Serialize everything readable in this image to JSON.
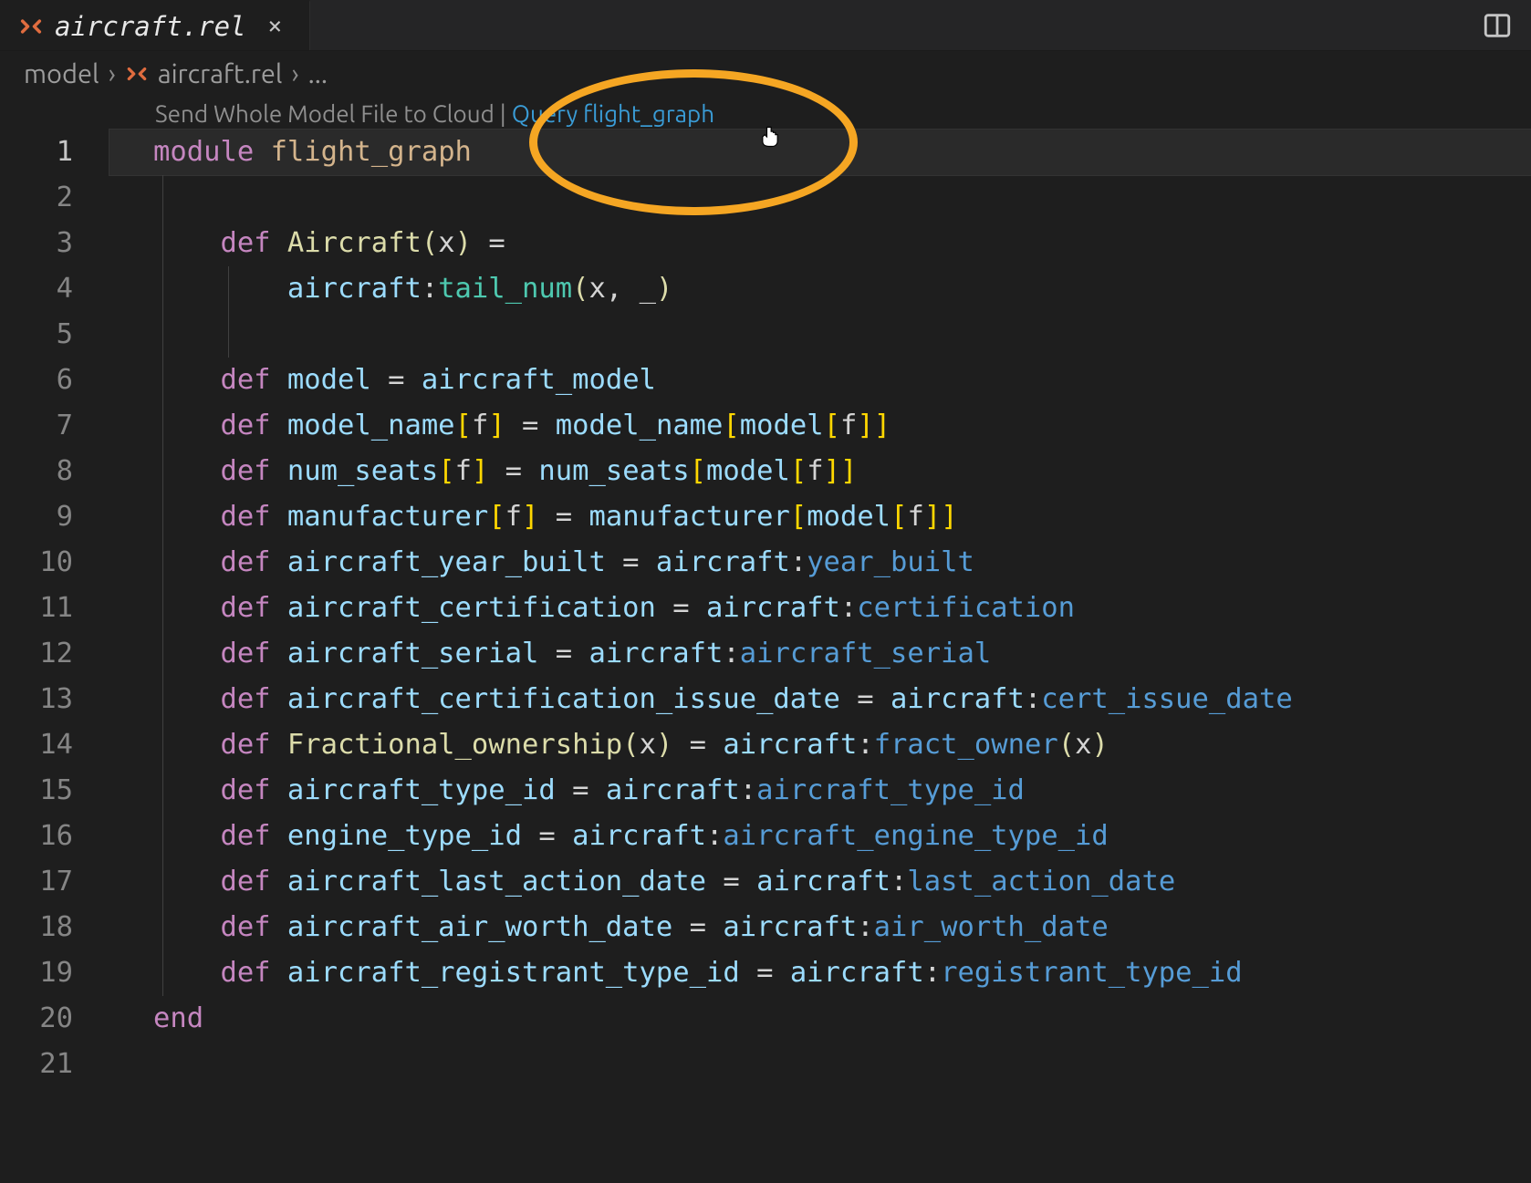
{
  "tab": {
    "filename": "aircraft.rel",
    "close_glyph": "×",
    "icon_name": "rel-file-icon"
  },
  "breadcrumbs": {
    "items": [
      {
        "label": "model",
        "icon": null
      },
      {
        "label": "aircraft.rel",
        "icon": "rel-file-icon"
      },
      {
        "label": "...",
        "icon": null
      }
    ],
    "separator": "›"
  },
  "codelens": {
    "send_label": "Send Whole Model File to Cloud",
    "separator": "|",
    "query_label": "Query flight_graph"
  },
  "annotation": {
    "highlight_color": "#f5a623",
    "cursor_icon": "pointer-hand"
  },
  "code": {
    "lines": [
      {
        "n": 1,
        "current": true,
        "tokens": [
          {
            "t": "module",
            "c": "kw-module"
          },
          {
            "t": " ",
            "c": "plain"
          },
          {
            "t": "flight_graph",
            "c": "flightg"
          }
        ]
      },
      {
        "n": 2,
        "tokens": []
      },
      {
        "n": 3,
        "indent": 2,
        "tokens": [
          {
            "t": "def",
            "c": "kw-def"
          },
          {
            "t": " ",
            "c": "plain"
          },
          {
            "t": "Aircraft",
            "c": "fnname"
          },
          {
            "t": "(",
            "c": "paren"
          },
          {
            "t": "x",
            "c": "plain"
          },
          {
            "t": ")",
            "c": "paren"
          },
          {
            "t": " = ",
            "c": "op"
          }
        ]
      },
      {
        "n": 4,
        "indent": 3,
        "tokens": [
          {
            "t": "aircraft",
            "c": "ns"
          },
          {
            "t": ":",
            "c": "plain"
          },
          {
            "t": "tail_num",
            "c": "prop"
          },
          {
            "t": "(",
            "c": "paren"
          },
          {
            "t": "x",
            "c": "plain"
          },
          {
            "t": ", ",
            "c": "plain"
          },
          {
            "t": "_",
            "c": "under"
          },
          {
            "t": ")",
            "c": "paren"
          }
        ]
      },
      {
        "n": 5,
        "tokens": []
      },
      {
        "n": 6,
        "indent": 2,
        "tokens": [
          {
            "t": "def",
            "c": "kw-def"
          },
          {
            "t": " ",
            "c": "plain"
          },
          {
            "t": "model",
            "c": "ident"
          },
          {
            "t": " = ",
            "c": "op"
          },
          {
            "t": "aircraft_model",
            "c": "ident"
          }
        ]
      },
      {
        "n": 7,
        "indent": 2,
        "tokens": [
          {
            "t": "def",
            "c": "kw-def"
          },
          {
            "t": " ",
            "c": "plain"
          },
          {
            "t": "model_name",
            "c": "ident"
          },
          {
            "t": "[",
            "c": "bracket"
          },
          {
            "t": "f",
            "c": "plain"
          },
          {
            "t": "]",
            "c": "bracket"
          },
          {
            "t": " = ",
            "c": "op"
          },
          {
            "t": "model_name",
            "c": "ident"
          },
          {
            "t": "[",
            "c": "bracket"
          },
          {
            "t": "model",
            "c": "ident"
          },
          {
            "t": "[",
            "c": "bracket"
          },
          {
            "t": "f",
            "c": "plain"
          },
          {
            "t": "]",
            "c": "bracket"
          },
          {
            "t": "]",
            "c": "bracket"
          }
        ]
      },
      {
        "n": 8,
        "indent": 2,
        "tokens": [
          {
            "t": "def",
            "c": "kw-def"
          },
          {
            "t": " ",
            "c": "plain"
          },
          {
            "t": "num_seats",
            "c": "ident"
          },
          {
            "t": "[",
            "c": "bracket"
          },
          {
            "t": "f",
            "c": "plain"
          },
          {
            "t": "]",
            "c": "bracket"
          },
          {
            "t": " = ",
            "c": "op"
          },
          {
            "t": "num_seats",
            "c": "ident"
          },
          {
            "t": "[",
            "c": "bracket"
          },
          {
            "t": "model",
            "c": "ident"
          },
          {
            "t": "[",
            "c": "bracket"
          },
          {
            "t": "f",
            "c": "plain"
          },
          {
            "t": "]",
            "c": "bracket"
          },
          {
            "t": "]",
            "c": "bracket"
          }
        ]
      },
      {
        "n": 9,
        "indent": 2,
        "tokens": [
          {
            "t": "def",
            "c": "kw-def"
          },
          {
            "t": " ",
            "c": "plain"
          },
          {
            "t": "manufacturer",
            "c": "ident"
          },
          {
            "t": "[",
            "c": "bracket"
          },
          {
            "t": "f",
            "c": "plain"
          },
          {
            "t": "]",
            "c": "bracket"
          },
          {
            "t": " = ",
            "c": "op"
          },
          {
            "t": "manufacturer",
            "c": "ident"
          },
          {
            "t": "[",
            "c": "bracket"
          },
          {
            "t": "model",
            "c": "ident"
          },
          {
            "t": "[",
            "c": "bracket"
          },
          {
            "t": "f",
            "c": "plain"
          },
          {
            "t": "]",
            "c": "bracket"
          },
          {
            "t": "]",
            "c": "bracket"
          }
        ]
      },
      {
        "n": 10,
        "indent": 2,
        "tokens": [
          {
            "t": "def",
            "c": "kw-def"
          },
          {
            "t": " ",
            "c": "plain"
          },
          {
            "t": "aircraft_year_built",
            "c": "ident"
          },
          {
            "t": " = ",
            "c": "op"
          },
          {
            "t": "aircraft",
            "c": "ns"
          },
          {
            "t": ":",
            "c": "plain"
          },
          {
            "t": "year_built",
            "c": "prop2"
          }
        ]
      },
      {
        "n": 11,
        "indent": 2,
        "tokens": [
          {
            "t": "def",
            "c": "kw-def"
          },
          {
            "t": " ",
            "c": "plain"
          },
          {
            "t": "aircraft_certification",
            "c": "ident"
          },
          {
            "t": " = ",
            "c": "op"
          },
          {
            "t": "aircraft",
            "c": "ns"
          },
          {
            "t": ":",
            "c": "plain"
          },
          {
            "t": "certification",
            "c": "prop2"
          }
        ]
      },
      {
        "n": 12,
        "indent": 2,
        "tokens": [
          {
            "t": "def",
            "c": "kw-def"
          },
          {
            "t": " ",
            "c": "plain"
          },
          {
            "t": "aircraft_serial",
            "c": "ident"
          },
          {
            "t": " = ",
            "c": "op"
          },
          {
            "t": "aircraft",
            "c": "ns"
          },
          {
            "t": ":",
            "c": "plain"
          },
          {
            "t": "aircraft_serial",
            "c": "prop2"
          }
        ]
      },
      {
        "n": 13,
        "indent": 2,
        "tokens": [
          {
            "t": "def",
            "c": "kw-def"
          },
          {
            "t": " ",
            "c": "plain"
          },
          {
            "t": "aircraft_certification_issue_date",
            "c": "ident"
          },
          {
            "t": " = ",
            "c": "op"
          },
          {
            "t": "aircraft",
            "c": "ns"
          },
          {
            "t": ":",
            "c": "plain"
          },
          {
            "t": "cert_issue_date",
            "c": "prop2"
          }
        ]
      },
      {
        "n": 14,
        "indent": 2,
        "tokens": [
          {
            "t": "def",
            "c": "kw-def"
          },
          {
            "t": " ",
            "c": "plain"
          },
          {
            "t": "Fractional_ownership",
            "c": "fnname"
          },
          {
            "t": "(",
            "c": "paren"
          },
          {
            "t": "x",
            "c": "plain"
          },
          {
            "t": ")",
            "c": "paren"
          },
          {
            "t": " = ",
            "c": "op"
          },
          {
            "t": "aircraft",
            "c": "ns"
          },
          {
            "t": ":",
            "c": "plain"
          },
          {
            "t": "fract_owner",
            "c": "prop2"
          },
          {
            "t": "(",
            "c": "paren"
          },
          {
            "t": "x",
            "c": "plain"
          },
          {
            "t": ")",
            "c": "paren"
          }
        ]
      },
      {
        "n": 15,
        "indent": 2,
        "tokens": [
          {
            "t": "def",
            "c": "kw-def"
          },
          {
            "t": " ",
            "c": "plain"
          },
          {
            "t": "aircraft_type_id",
            "c": "ident"
          },
          {
            "t": " = ",
            "c": "op"
          },
          {
            "t": "aircraft",
            "c": "ns"
          },
          {
            "t": ":",
            "c": "plain"
          },
          {
            "t": "aircraft_type_id",
            "c": "prop2"
          }
        ]
      },
      {
        "n": 16,
        "indent": 2,
        "tokens": [
          {
            "t": "def",
            "c": "kw-def"
          },
          {
            "t": " ",
            "c": "plain"
          },
          {
            "t": "engine_type_id",
            "c": "ident"
          },
          {
            "t": " = ",
            "c": "op"
          },
          {
            "t": "aircraft",
            "c": "ns"
          },
          {
            "t": ":",
            "c": "plain"
          },
          {
            "t": "aircraft_engine_type_id",
            "c": "prop2"
          }
        ]
      },
      {
        "n": 17,
        "indent": 2,
        "tokens": [
          {
            "t": "def",
            "c": "kw-def"
          },
          {
            "t": " ",
            "c": "plain"
          },
          {
            "t": "aircraft_last_action_date",
            "c": "ident"
          },
          {
            "t": " = ",
            "c": "op"
          },
          {
            "t": "aircraft",
            "c": "ns"
          },
          {
            "t": ":",
            "c": "plain"
          },
          {
            "t": "last_action_date",
            "c": "prop2"
          }
        ]
      },
      {
        "n": 18,
        "indent": 2,
        "tokens": [
          {
            "t": "def",
            "c": "kw-def"
          },
          {
            "t": " ",
            "c": "plain"
          },
          {
            "t": "aircraft_air_worth_date",
            "c": "ident"
          },
          {
            "t": " = ",
            "c": "op"
          },
          {
            "t": "aircraft",
            "c": "ns"
          },
          {
            "t": ":",
            "c": "plain"
          },
          {
            "t": "air_worth_date",
            "c": "prop2"
          }
        ]
      },
      {
        "n": 19,
        "indent": 2,
        "tokens": [
          {
            "t": "def",
            "c": "kw-def"
          },
          {
            "t": " ",
            "c": "plain"
          },
          {
            "t": "aircraft_registrant_type_id",
            "c": "ident"
          },
          {
            "t": " = ",
            "c": "op"
          },
          {
            "t": "aircraft",
            "c": "ns"
          },
          {
            "t": ":",
            "c": "plain"
          },
          {
            "t": "registrant_type_id",
            "c": "prop2"
          }
        ]
      },
      {
        "n": 20,
        "tokens": [
          {
            "t": "end",
            "c": "kw-end"
          }
        ]
      },
      {
        "n": 21,
        "tokens": []
      }
    ]
  }
}
